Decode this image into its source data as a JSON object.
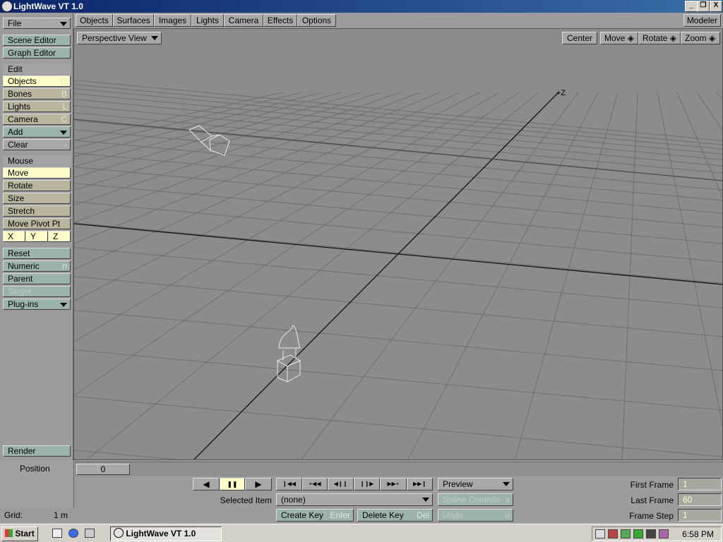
{
  "window": {
    "title": "LightWave VT 1.0",
    "min": "_",
    "max": "❐",
    "close": "X"
  },
  "left_panel": {
    "file": "File",
    "scene_editor": "Scene Editor",
    "graph_editor": "Graph Editor",
    "edit_header": "Edit",
    "objects": {
      "label": "Objects",
      "key": "O"
    },
    "bones": {
      "label": "Bones",
      "key": "B"
    },
    "lights": {
      "label": "Lights",
      "key": "L"
    },
    "camera": {
      "label": "Camera",
      "key": "C"
    },
    "add": "Add",
    "clear": {
      "label": "Clear",
      "key": "-"
    },
    "mouse_header": "Mouse",
    "move": "Move",
    "rotate": "Rotate",
    "size": "Size",
    "stretch": "Stretch",
    "move_pivot": "Move Pivot Pt",
    "axis_x": "X",
    "axis_y": "Y",
    "axis_z": "Z",
    "reset": "Reset",
    "numeric": {
      "label": "Numeric",
      "key": "n"
    },
    "parent": "Parent",
    "target": "Target",
    "plugins": "Plug-ins",
    "render": "Render"
  },
  "menu": {
    "items": [
      "Objects",
      "Surfaces",
      "Images",
      "Lights",
      "Camera",
      "Effects",
      "Options"
    ],
    "modeler": "Modeler"
  },
  "viewport": {
    "view_mode": "Perspective View",
    "center": "Center",
    "move": "Move",
    "rotate": "Rotate",
    "zoom": "Zoom",
    "axis_label": "+Z"
  },
  "bottom": {
    "position_label": "Position",
    "position_value": "0",
    "grid_label": "Grid:",
    "grid_value": "1 m",
    "play_back": "◀",
    "pause": "❚❚",
    "play_fwd": "▶",
    "first_key": "❙◀◀",
    "prev_key": "+◀◀",
    "prev_frame": "◀❙❙",
    "next_frame": "❙❙▶",
    "next_key": "▶▶+",
    "last_key": "▶▶❙",
    "preview": "Preview",
    "selected_item_label": "Selected Item",
    "selected_item_value": "(none)",
    "spline_controls": {
      "label": "Spline Controls",
      "key": "s"
    },
    "create_key": {
      "label": "Create Key",
      "key": "Enter"
    },
    "delete_key": {
      "label": "Delete Key",
      "key": "Del"
    },
    "undo": {
      "label": "Undo",
      "key": "u"
    },
    "first_frame_label": "First Frame",
    "first_frame_value": "1",
    "last_frame_label": "Last Frame",
    "last_frame_value": "60",
    "frame_step_label": "Frame Step",
    "frame_step_value": "1"
  },
  "taskbar": {
    "start": "Start",
    "task": "LightWave VT 1.0",
    "clock": "6:58 PM"
  }
}
